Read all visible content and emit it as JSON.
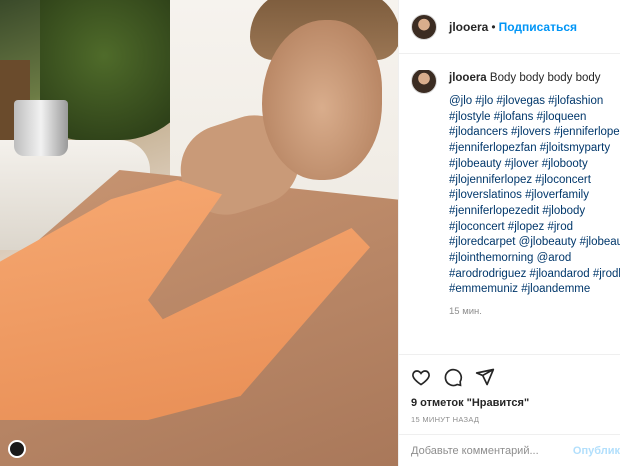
{
  "post": {
    "username": "jlooera",
    "separator": "•",
    "follow_label": "Подписаться",
    "caption_user": "jlooera",
    "caption_text": " Body body body body",
    "hashtag_lines": [
      "@jlo #jlo #jlovegas #jlofashion",
      "#jlostyle #jlofans #jloqueen",
      "#jlodancers #jlovers #jenniferlopez",
      "#jenniferlopezfan #jloitsmyparty",
      "#jlobeauty #jlover #jlobooty",
      "#jlojenniferlopez #jloconcert",
      "#jloverslatinos #jloverfamily",
      "#jenniferlopezedit #jlobody",
      "#jloconcert #jlopez #jrod",
      "#jloredcarpet @jlobeauty #jlobeauty",
      "#jlointhemorning @arod",
      "#arodrodriguez #jloandarod #jrodk",
      "#emmemuniz #jloandemme"
    ],
    "time_ago": "15 мин.",
    "likes": "9 отметок \"Нравится\"",
    "date": "15 МИНУТ НАЗАД",
    "comment_placeholder": "Добавьте комментарий...",
    "publish_label": "Опублик"
  },
  "icons": {
    "like": "heart-icon",
    "comment": "comment-icon",
    "share": "share-icon"
  },
  "colors": {
    "link": "#0095f6",
    "hashtag": "#00376b",
    "muted": "#8e8e8e",
    "publish_disabled": "#b2dffc"
  }
}
